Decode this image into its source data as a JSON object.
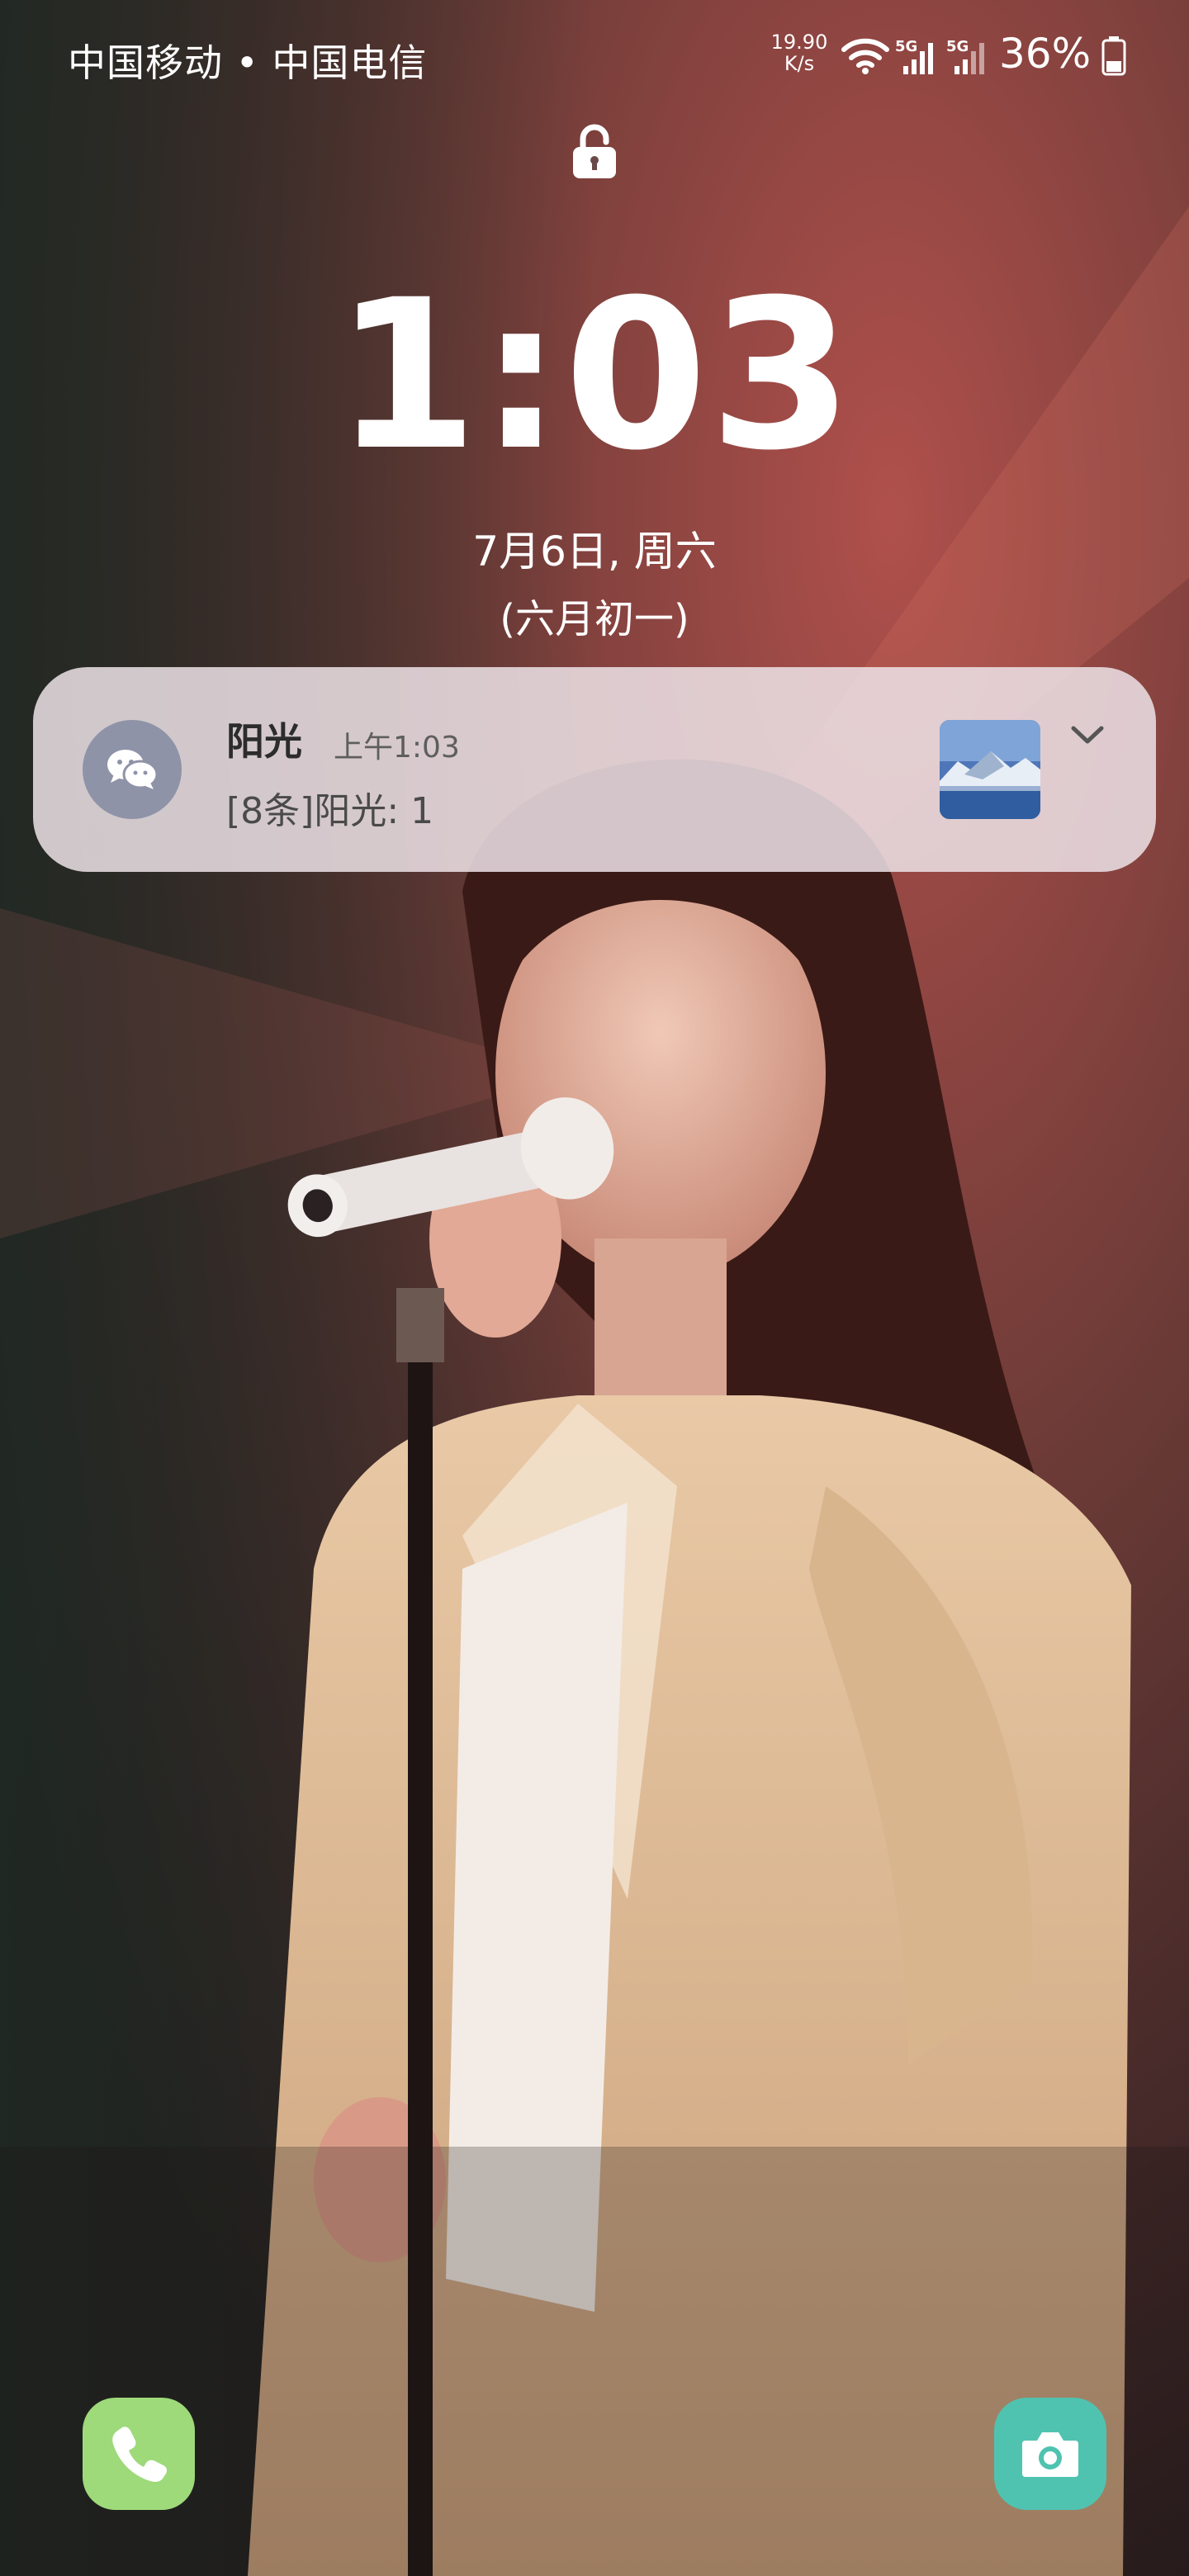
{
  "status_bar": {
    "carrier": "中国移动 • 中国电信",
    "net_speed_value": "19.90",
    "net_speed_unit": "K/s",
    "sim1_label": "5G",
    "sim2_label": "5G",
    "battery_percent": "36%",
    "icons": [
      "wifi-icon",
      "signal-icon",
      "signal-icon",
      "battery-icon"
    ]
  },
  "lock": {
    "icon": "lock-icon"
  },
  "clock": {
    "time": "1:03",
    "date": "7月6日, 周六",
    "lunar": "(六月初一)"
  },
  "notification": {
    "app_icon": "wechat-icon",
    "title": "阳光",
    "time": "上午1:03",
    "body": "[8条]阳光: 1",
    "expand_icon": "chevron-down-icon"
  },
  "shortcuts": {
    "left_icon": "phone-icon",
    "right_icon": "camera-icon",
    "left_color": "#9ed97a",
    "right_color": "#4fc3b0"
  }
}
